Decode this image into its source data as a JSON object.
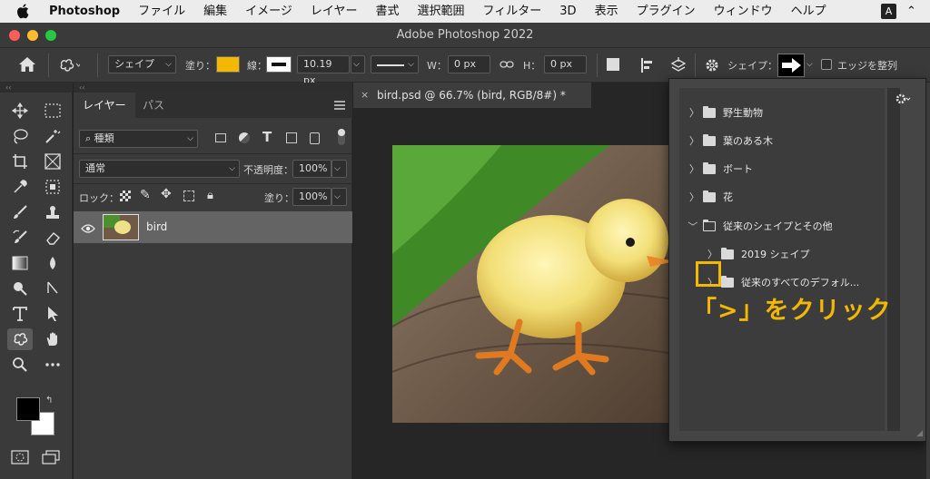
{
  "menubar": {
    "app": "Photoshop",
    "items": [
      "ファイル",
      "編集",
      "イメージ",
      "レイヤー",
      "書式",
      "選択範囲",
      "フィルター",
      "3D",
      "表示",
      "プラグイン",
      "ウィンドウ",
      "ヘルプ"
    ],
    "input_badge": "A",
    "overflow": "⌃"
  },
  "window": {
    "title": "Adobe Photoshop 2022",
    "traffic_colors": [
      "#ff5f57",
      "#febc2e",
      "#28c840"
    ]
  },
  "options": {
    "mode_label": "シェイプ",
    "fill_label": "塗り：",
    "fill_color": "#f5b800",
    "stroke_label": "線：",
    "stroke_size": "10.19 px",
    "w_label": "W：",
    "w_value": "0 px",
    "h_label": "H：",
    "h_value": "0 px",
    "shape_label": "シェイプ：",
    "align_edges": "エッジを整列"
  },
  "layers": {
    "tab_layers": "レイヤー",
    "tab_paths": "パス",
    "filter_kind": "種類",
    "blend_mode": "通常",
    "opacity_label": "不透明度：",
    "opacity": "100%",
    "lock_label": "ロック：",
    "fill_label": "塗り：",
    "fill": "100%",
    "layer_name": "bird"
  },
  "document": {
    "tab_title": "bird.psd @ 66.7% (bird, RGB/8#) *"
  },
  "shapes_panel": {
    "items": [
      {
        "label": "野生動物",
        "expanded": false,
        "indent": 0
      },
      {
        "label": "葉のある木",
        "expanded": false,
        "indent": 0
      },
      {
        "label": "ボート",
        "expanded": false,
        "indent": 0
      },
      {
        "label": "花",
        "expanded": false,
        "indent": 0
      },
      {
        "label": "従来のシェイプとその他",
        "expanded": true,
        "indent": 0
      },
      {
        "label": "2019 シェイプ",
        "expanded": false,
        "indent": 1
      },
      {
        "label": "従来のすべてのデフォル...",
        "expanded": false,
        "indent": 1
      }
    ]
  },
  "annotation": {
    "text": "「>」をクリック",
    "color": "#f5b800"
  },
  "colors": {
    "foreground": "#000000",
    "background": "#ffffff"
  }
}
